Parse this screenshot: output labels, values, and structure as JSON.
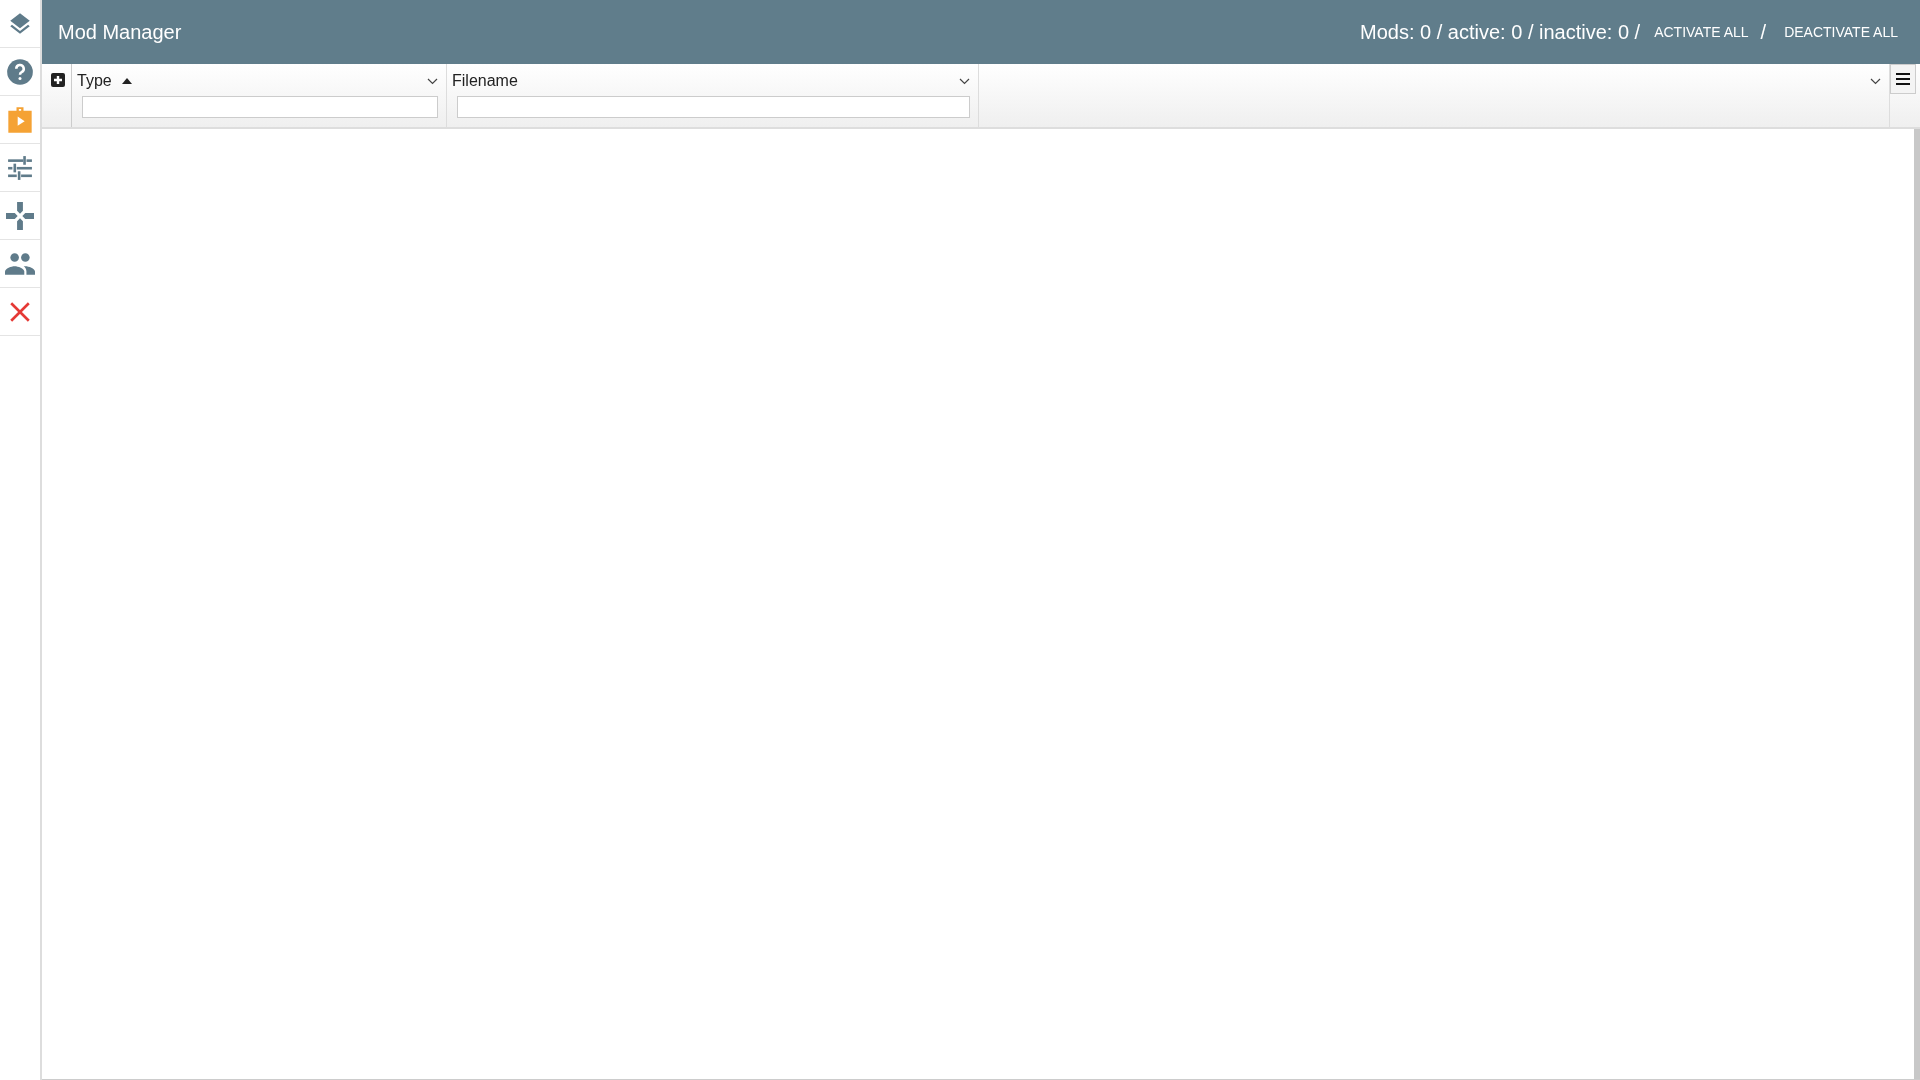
{
  "sidebar": {
    "items": [
      {
        "kind": "layers",
        "selected": false
      },
      {
        "kind": "help",
        "selected": false
      },
      {
        "kind": "mods",
        "selected": true
      },
      {
        "kind": "settings",
        "selected": false
      },
      {
        "kind": "gamepad",
        "selected": false
      },
      {
        "kind": "people",
        "selected": false
      },
      {
        "kind": "close",
        "selected": false
      }
    ]
  },
  "header": {
    "title": "Mod Manager",
    "stats": "Mods: 0 / active: 0 / inactive: 0 /",
    "activate_button": "ACTIVATE ALL",
    "separator": "/",
    "deactivate_button": "DEACTIVATE ALL"
  },
  "table": {
    "columns": [
      {
        "label": "Type",
        "sorted": true
      },
      {
        "label": "Filename",
        "sorted": false
      }
    ]
  }
}
